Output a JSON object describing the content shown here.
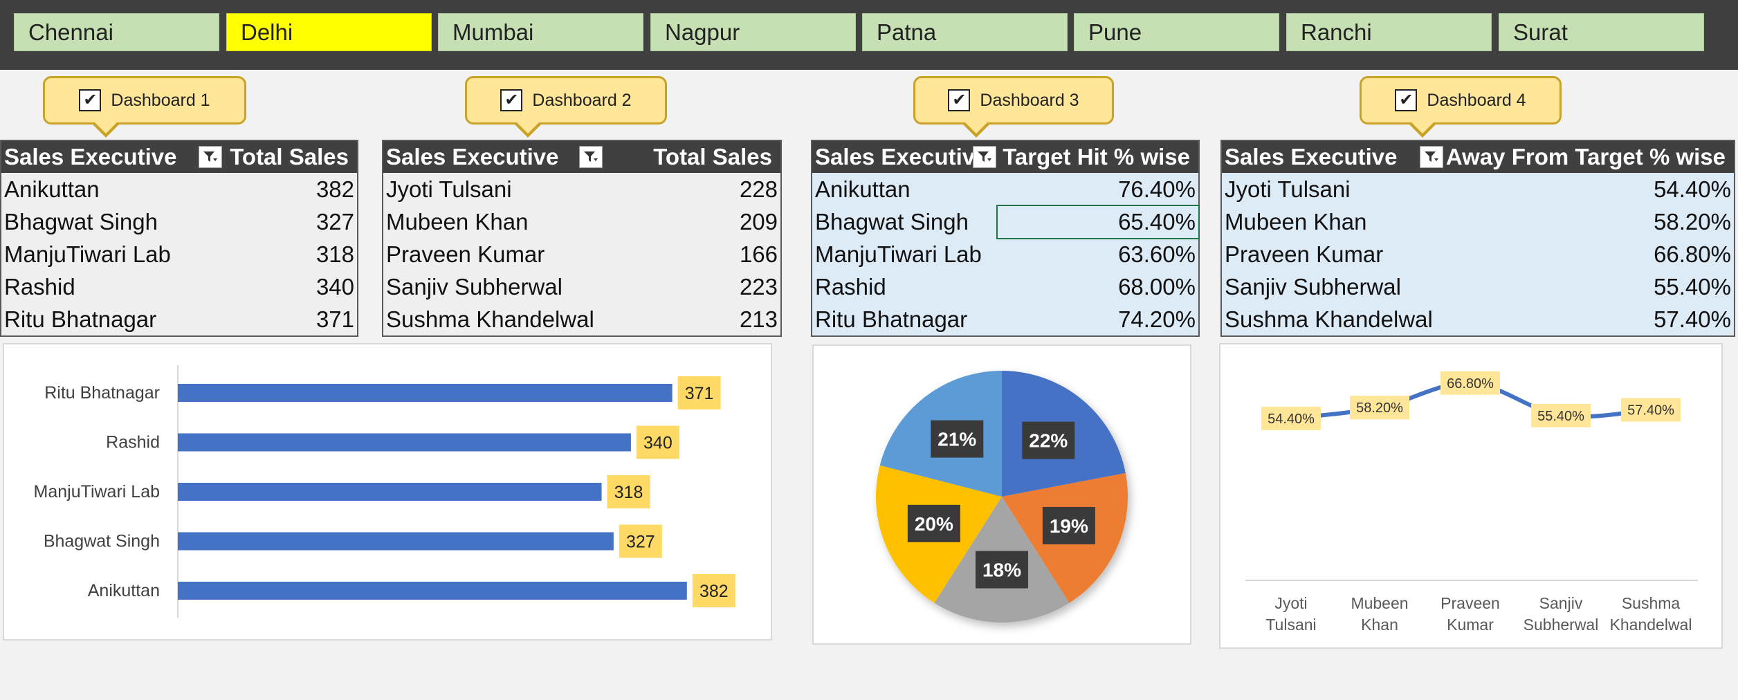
{
  "slicer": {
    "cities": [
      "Chennai",
      "Delhi",
      "Mumbai",
      "Nagpur",
      "Patna",
      "Pune",
      "Ranchi",
      "Surat"
    ],
    "selected": "Delhi",
    "selected_color": "#ffff00",
    "item_color": "#c6e0b4"
  },
  "dashboards": [
    {
      "label": "Dashboard 1",
      "checked": true,
      "checkbox_icon": "checkmark",
      "columns": [
        "Sales Executive",
        "Total Sales"
      ],
      "rows": [
        [
          "Anikuttan",
          "382"
        ],
        [
          "Bhagwat Singh",
          "327"
        ],
        [
          "ManjuTiwari Lab",
          "318"
        ],
        [
          "Rashid",
          "340"
        ],
        [
          "Ritu Bhatnagar",
          "371"
        ]
      ]
    },
    {
      "label": "Dashboard 2",
      "checked": true,
      "checkbox_icon": "checkmark",
      "columns": [
        "Sales Executive",
        "Total Sales"
      ],
      "rows": [
        [
          "Jyoti Tulsani",
          "228"
        ],
        [
          "Mubeen Khan",
          "209"
        ],
        [
          "Praveen Kumar",
          "166"
        ],
        [
          "Sanjiv Subherwal",
          "223"
        ],
        [
          "Sushma Khandelwal",
          "213"
        ]
      ]
    },
    {
      "label": "Dashboard 3",
      "checked": true,
      "checkbox_icon": "checkmark",
      "columns": [
        "Sales Executive",
        "Target Hit % wise"
      ],
      "rows": [
        [
          "Anikuttan",
          "76.40%"
        ],
        [
          "Bhagwat Singh",
          "65.40%"
        ],
        [
          "ManjuTiwari Lab",
          "63.60%"
        ],
        [
          "Rashid",
          "68.00%"
        ],
        [
          "Ritu Bhatnagar",
          "74.20%"
        ]
      ]
    },
    {
      "label": "Dashboard 4",
      "checked": true,
      "checkbox_icon": "checkmark",
      "columns": [
        "Sales Executive",
        "Away From Target % wise"
      ],
      "rows": [
        [
          "Jyoti Tulsani",
          "54.40%"
        ],
        [
          "Mubeen Khan",
          "58.20%"
        ],
        [
          "Praveen Kumar",
          "66.80%"
        ],
        [
          "Sanjiv Subherwal",
          "55.40%"
        ],
        [
          "Sushma Khandelwal",
          "57.40%"
        ]
      ]
    }
  ],
  "filter_icon": "filter-icon",
  "chart_data": [
    {
      "type": "bar",
      "orientation": "horizontal",
      "categories": [
        "Ritu Bhatnagar",
        "Rashid",
        "ManjuTiwari Lab",
        "Bhagwat Singh",
        "Anikuttan"
      ],
      "values": [
        371,
        340,
        318,
        327,
        382
      ],
      "data_labels": [
        "371",
        "340",
        "318",
        "327",
        "382"
      ],
      "xlim": [
        0,
        420
      ],
      "bar_color": "#4472c4",
      "label_bg": "#ffd966",
      "grid": false
    },
    {
      "type": "pie",
      "categories": [
        "Anikuttan",
        "Bhagwat Singh",
        "ManjuTiwari Lab",
        "Rashid",
        "Ritu Bhatnagar"
      ],
      "values": [
        22,
        19,
        18,
        20,
        21
      ],
      "data_labels": [
        "22%",
        "19%",
        "18%",
        "20%",
        "21%"
      ],
      "colors": [
        "#4472c4",
        "#ed7d31",
        "#a5a5a5",
        "#ffc000",
        "#5b9bd5"
      ]
    },
    {
      "type": "line",
      "categories": [
        [
          "Jyoti",
          "Tulsani"
        ],
        [
          "Mubeen",
          "Khan"
        ],
        [
          "Praveen",
          "Kumar"
        ],
        [
          "Sanjiv",
          "Subherwal"
        ],
        [
          "Sushma",
          "Khandelwal"
        ]
      ],
      "values": [
        54.4,
        58.2,
        66.8,
        55.4,
        57.4
      ],
      "data_labels": [
        "54.40%",
        "58.20%",
        "66.80%",
        "55.40%",
        "57.40%"
      ],
      "ylim": [
        0,
        75
      ],
      "line_color": "#4472c4",
      "label_bg": "#ffe699",
      "grid": false
    }
  ]
}
